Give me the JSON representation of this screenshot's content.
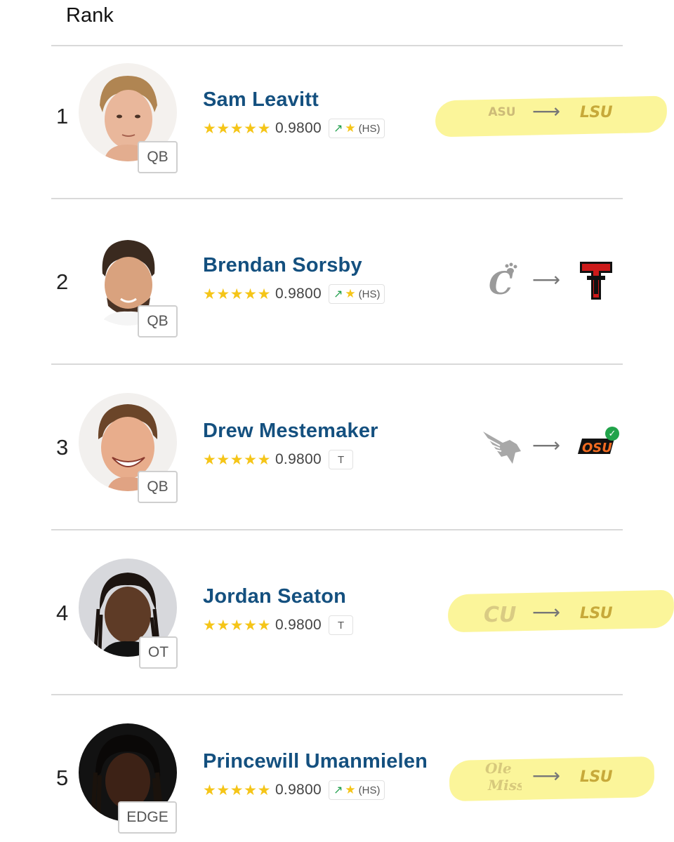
{
  "header": {
    "title": "Rank"
  },
  "players": [
    {
      "rank": "1",
      "name": "Sam Leavitt",
      "position": "QB",
      "rating": "0.9800",
      "chip": {
        "type": "hs",
        "label": "(HS)"
      },
      "from_school": "ASU",
      "to_school": "LSU",
      "highlighted": true,
      "to_committed": false
    },
    {
      "rank": "2",
      "name": "Brendan Sorsby",
      "position": "QB",
      "rating": "0.9800",
      "chip": {
        "type": "hs",
        "label": "(HS)"
      },
      "from_school": "cincinnati-logo",
      "to_school": "texas-tech-logo",
      "highlighted": false,
      "to_committed": false
    },
    {
      "rank": "3",
      "name": "Drew Mestemaker",
      "position": "QB",
      "rating": "0.9800",
      "chip": {
        "type": "transfer",
        "label": "T"
      },
      "from_school": "north-texas-logo",
      "to_school": "oklahoma-state-logo",
      "highlighted": false,
      "to_committed": true
    },
    {
      "rank": "4",
      "name": "Jordan Seaton",
      "position": "OT",
      "rating": "0.9800",
      "chip": {
        "type": "transfer",
        "label": "T"
      },
      "from_school": "colorado-logo",
      "to_school": "LSU",
      "highlighted": true,
      "to_committed": false
    },
    {
      "rank": "5",
      "name": "Princewill Umanmielen",
      "position": "EDGE",
      "rating": "0.9800",
      "chip": {
        "type": "hs",
        "label": "(HS)"
      },
      "from_school": "ole-miss-logo",
      "to_school": "LSU",
      "highlighted": true,
      "to_committed": false
    }
  ],
  "colors": {
    "name": "#14507f",
    "star": "#f5c518",
    "trend": "#1e9e4a",
    "highlight": "#fbf59a",
    "lsu_gold": "#c7a93a"
  }
}
